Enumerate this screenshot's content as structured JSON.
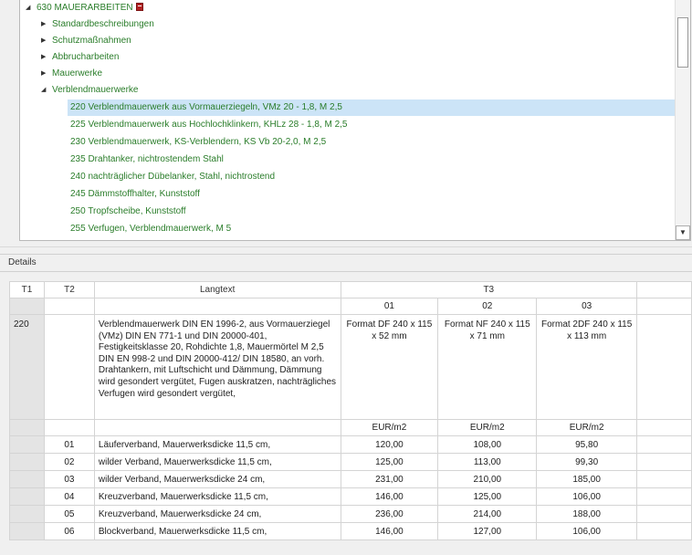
{
  "tree": {
    "root": {
      "label": "630 MAUERARBEITEN"
    },
    "groups": [
      {
        "label": "Standardbeschreibungen"
      },
      {
        "label": "Schutzmaßnahmen"
      },
      {
        "label": "Abbrucharbeiten"
      },
      {
        "label": "Mauerwerke"
      },
      {
        "label": "Verblendmauerwerke"
      }
    ],
    "items": [
      {
        "label": "220 Verblendmauerwerk aus Vormauerziegeln, VMz 20 - 1,8, M 2,5",
        "selected": true
      },
      {
        "label": "225 Verblendmauerwerk aus Hochlochklinkern, KHLz 28 - 1,8, M 2,5"
      },
      {
        "label": "230 Verblendmauerwerk, KS-Verblendern, KS Vb 20-2,0, M 2,5"
      },
      {
        "label": "235 Drahtanker, nichtrostendem Stahl"
      },
      {
        "label": "240 nachträglicher Dübelanker, Stahl, nichtrostend"
      },
      {
        "label": "245 Dämmstoffhalter, Kunststoff"
      },
      {
        "label": "250 Tropfscheibe, Kunststoff"
      },
      {
        "label": "255 Verfugen, Verblendmauerwerk, M 5"
      }
    ]
  },
  "details": {
    "header": "Details",
    "columns": {
      "t1": "T1",
      "t2": "T2",
      "langtext": "Langtext",
      "t3": "T3"
    },
    "subcolumns": [
      "01",
      "02",
      "03"
    ],
    "main_row": {
      "t1": "220",
      "langtext": "Verblendmauerwerk DIN EN 1996-2, aus Vormauerziegel (VMz) DIN EN 771-1 und DIN 20000-401, Festigkeitsklasse 20, Rohdichte 1,8, Mauermörtel M 2,5 DIN EN 998-2 und DIN 20000-412/ DIN 18580, an vorh. Drahtankern, mit Luftschicht und Dämmung, Dämmung wird gesondert vergütet, Fugen auskratzen, nachträgliches Verfugen wird gesondert vergütet,",
      "formats": [
        "Format DF 240 x 115 x 52 mm",
        "Format NF 240 x 115 x 71 mm",
        "Format 2DF 240 x 115 x 113 mm"
      ]
    },
    "units": [
      "EUR/m2",
      "EUR/m2",
      "EUR/m2"
    ],
    "rows": [
      {
        "t2": "01",
        "text": "Läuferverband, Mauerwerksdicke 11,5 cm,",
        "v": [
          "120,00",
          "108,00",
          "95,80"
        ]
      },
      {
        "t2": "02",
        "text": "wilder Verband, Mauerwerksdicke 11,5 cm,",
        "v": [
          "125,00",
          "113,00",
          "99,30"
        ]
      },
      {
        "t2": "03",
        "text": "wilder Verband, Mauerwerksdicke 24 cm,",
        "v": [
          "231,00",
          "210,00",
          "185,00"
        ]
      },
      {
        "t2": "04",
        "text": "Kreuzverband, Mauerwerksdicke 11,5 cm,",
        "v": [
          "146,00",
          "125,00",
          "106,00"
        ]
      },
      {
        "t2": "05",
        "text": "Kreuzverband, Mauerwerksdicke 24 cm,",
        "v": [
          "236,00",
          "214,00",
          "188,00"
        ]
      },
      {
        "t2": "06",
        "text": "Blockverband, Mauerwerksdicke 11,5 cm,",
        "v": [
          "146,00",
          "127,00",
          "106,00"
        ]
      }
    ]
  }
}
